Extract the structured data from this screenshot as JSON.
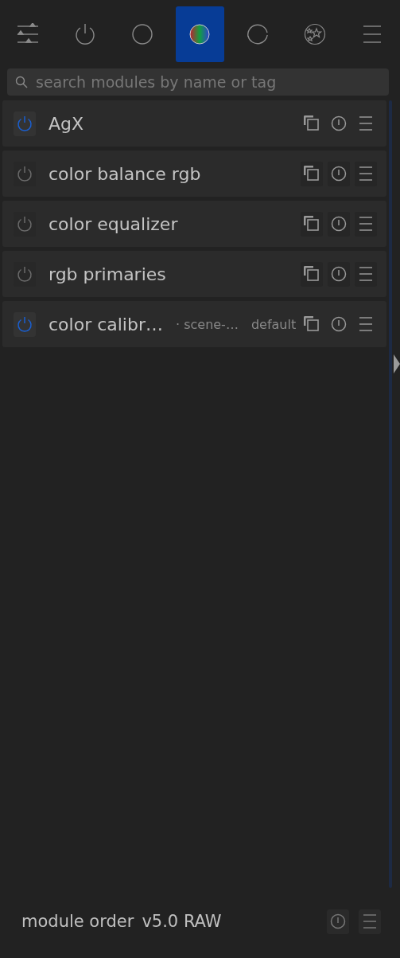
{
  "tabs": [
    {
      "kind": "sliders",
      "selected": false
    },
    {
      "kind": "power",
      "selected": false
    },
    {
      "kind": "circle",
      "selected": false
    },
    {
      "kind": "color",
      "selected": true
    },
    {
      "kind": "cycle",
      "selected": false
    },
    {
      "kind": "stars",
      "selected": false
    },
    {
      "kind": "menu",
      "selected": false
    }
  ],
  "search": {
    "placeholder": "search modules by name or tag"
  },
  "modules": [
    {
      "name": "AgX",
      "enabled": true
    },
    {
      "name": "color balance rgb",
      "enabled": false
    },
    {
      "name": "color equalizer",
      "enabled": false
    },
    {
      "name": "rgb primaries",
      "enabled": false
    },
    {
      "name": "color calibr…",
      "enabled": true,
      "label": "· scene-…",
      "preset": "default"
    }
  ],
  "footer": {
    "label": "module order",
    "value": "v5.0 RAW"
  }
}
